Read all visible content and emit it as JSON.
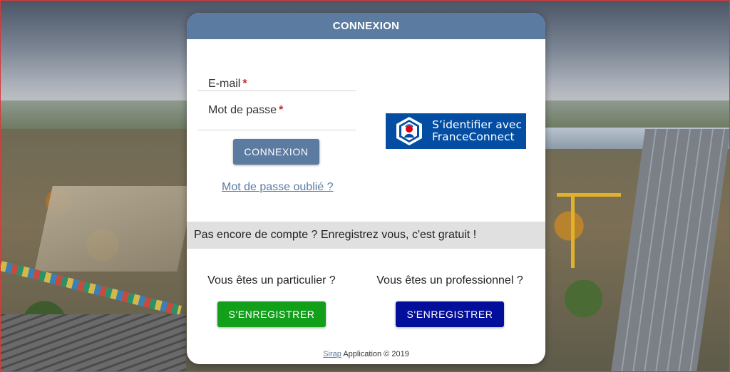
{
  "login": {
    "header_title": "CONNEXION",
    "email_label": "E-mail",
    "password_label": "Mot de passe",
    "required_marker": "*",
    "submit_label": "CONNEXION",
    "forgot_password_label": "Mot de passe oublié ?"
  },
  "franceconnect": {
    "line1": "S’identifier avec",
    "line2": "FranceConnect",
    "background_color": "#034ea2"
  },
  "register": {
    "banner_text": "Pas encore de compte ? Enregistrez vous, c'est gratuit !",
    "individual_question": "Vous êtes un particulier ?",
    "individual_button": "S'ENREGISTRER",
    "professional_question": "Vous êtes un professionnel ?",
    "professional_button": "S'ENREGISTRER"
  },
  "footer": {
    "brand_link": "Sirap",
    "text": "Application © 2019"
  },
  "colors": {
    "primary": "#5b7ba0",
    "individual_button": "#12a01b",
    "professional_button": "#030f9a",
    "required": "#c62828"
  }
}
